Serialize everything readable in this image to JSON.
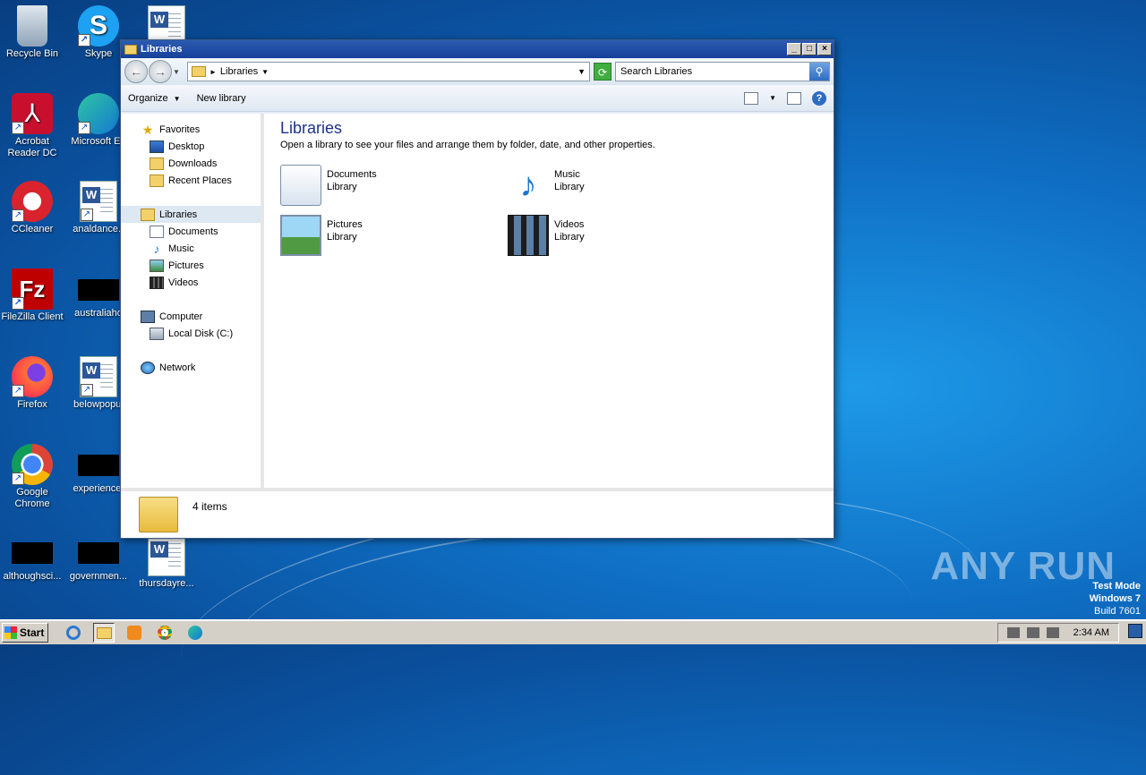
{
  "desktop": {
    "icons": [
      {
        "label": "Recycle Bin",
        "icon": "recycle-bin-icon"
      },
      {
        "label": "Skype",
        "icon": "skype-icon"
      },
      {
        "label": "Acrobat Reader DC",
        "icon": "acrobat-icon"
      },
      {
        "label": "Microsoft Ed",
        "icon": "edge-icon"
      },
      {
        "label": "CCleaner",
        "icon": "ccleaner-icon"
      },
      {
        "label": "analdance.r",
        "icon": "word-doc-icon"
      },
      {
        "label": "FileZilla Client",
        "icon": "filezilla-icon"
      },
      {
        "label": "australiaho",
        "icon": "redacted"
      },
      {
        "label": "Firefox",
        "icon": "firefox-icon"
      },
      {
        "label": "belowpopul",
        "icon": "word-doc-icon"
      },
      {
        "label": "Google Chrome",
        "icon": "chrome-icon"
      },
      {
        "label": "experiencef",
        "icon": "redacted"
      },
      {
        "label": "althoughsci...",
        "icon": "redacted"
      },
      {
        "label": "governmen...",
        "icon": "redacted"
      },
      {
        "label": "thursdayre...",
        "icon": "word-doc-icon"
      }
    ],
    "watermark": "ANY RUN",
    "test_mode": {
      "line1": "Test Mode",
      "line2": "Windows 7",
      "line3": "Build 7601"
    }
  },
  "window": {
    "title": "Libraries",
    "address": {
      "path": "Libraries"
    },
    "search": {
      "placeholder": "Search Libraries"
    },
    "toolbar": {
      "organize": "Organize",
      "new_library": "New library"
    },
    "nav": {
      "favorites": "Favorites",
      "desktop": "Desktop",
      "downloads": "Downloads",
      "recent_places": "Recent Places",
      "libraries": "Libraries",
      "documents": "Documents",
      "music": "Music",
      "pictures": "Pictures",
      "videos": "Videos",
      "computer": "Computer",
      "local_disk": "Local Disk (C:)",
      "network": "Network"
    },
    "content": {
      "heading": "Libraries",
      "description": "Open a library to see your files and arrange them by folder, date, and other properties.",
      "libraries": [
        {
          "name": "Documents",
          "type": "Library"
        },
        {
          "name": "Music",
          "type": "Library"
        },
        {
          "name": "Pictures",
          "type": "Library"
        },
        {
          "name": "Videos",
          "type": "Library"
        }
      ]
    },
    "status": {
      "count": "4 items"
    }
  },
  "taskbar": {
    "start": "Start",
    "clock": "2:34 AM"
  },
  "colors": {
    "title_bar": "#16409a",
    "heading": "#1e3287",
    "selection": "#dde8f3"
  }
}
